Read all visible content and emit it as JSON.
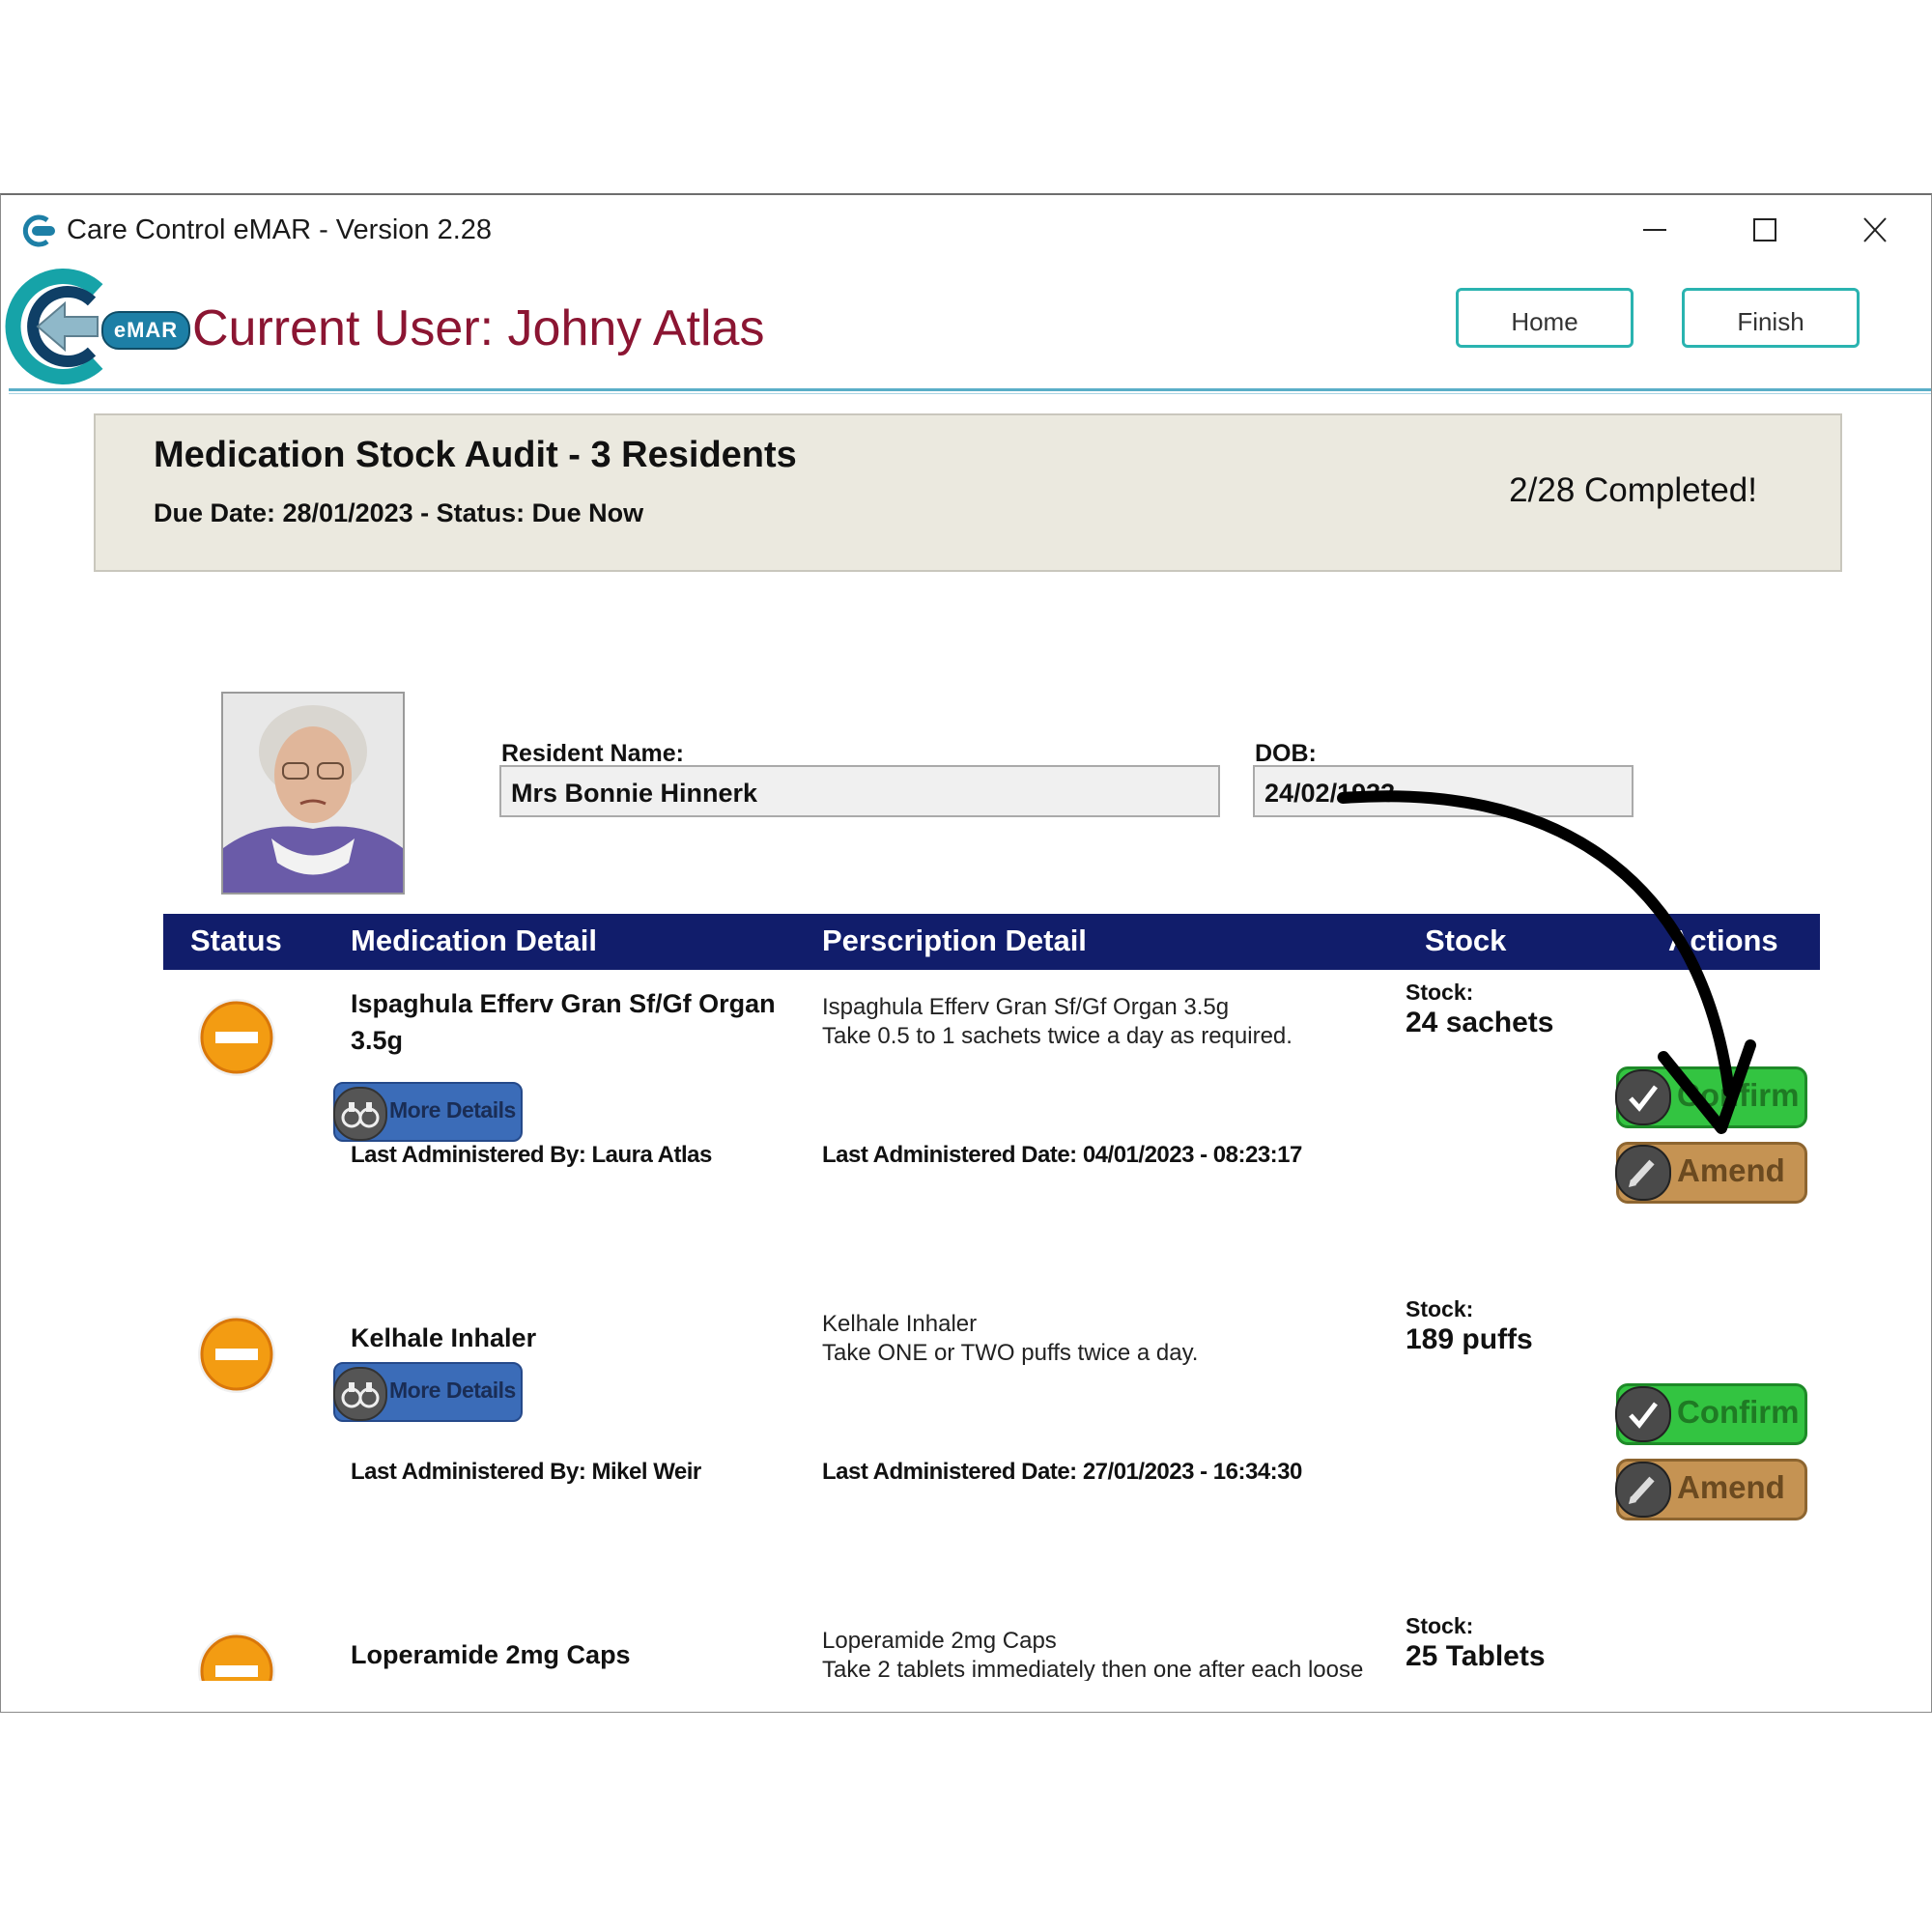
{
  "window": {
    "title": "Care Control eMAR - Version 2.28"
  },
  "header": {
    "badge": "eMAR",
    "current_user": "Current User: Johny Atlas",
    "home_label": "Home",
    "finish_label": "Finish"
  },
  "audit": {
    "title": "Medication Stock Audit - 3 Residents",
    "subtitle": "Due Date: 28/01/2023 - Status: Due Now",
    "progress": "2/28 Completed!"
  },
  "resident": {
    "name_label": "Resident Name:",
    "name": "Mrs Bonnie Hinnerk",
    "dob_label": "DOB:",
    "dob": "24/02/1933"
  },
  "table": {
    "headers": {
      "status": "Status",
      "medication": "Medication Detail",
      "prescription": "Perscription Detail",
      "stock": "Stock",
      "actions": "Actions"
    },
    "rows": [
      {
        "med_name": "Ispaghula Efferv Gran Sf/Gf Organ 3.5g",
        "more_details": "More Details",
        "last_admin_by": "Last Administered By: Laura Atlas",
        "pres_line1": "Ispaghula Efferv Gran Sf/Gf Organ 3.5g",
        "pres_line2": "Take 0.5 to 1 sachets twice a day as required.",
        "last_admin_date": "Last Administered Date: 04/01/2023 - 08:23:17",
        "stock_label": "Stock:",
        "stock": "24 sachets",
        "confirm": "Confirm",
        "amend": "Amend"
      },
      {
        "med_name": "Kelhale Inhaler",
        "more_details": "More Details",
        "last_admin_by": "Last Administered By: Mikel Weir",
        "pres_line1": "Kelhale Inhaler",
        "pres_line2": "Take ONE or TWO puffs twice a day.",
        "last_admin_date": "Last Administered Date: 27/01/2023 - 16:34:30",
        "stock_label": "Stock:",
        "stock": "189 puffs",
        "confirm": "Confirm",
        "amend": "Amend"
      },
      {
        "med_name": "Loperamide 2mg Caps",
        "pres_line1": "Loperamide 2mg Caps",
        "pres_line2": "Take 2 tablets immediately then one after each loose",
        "stock_label": "Stock:",
        "stock": "25 Tablets"
      }
    ]
  },
  "icons": {
    "status": "minus-circle-icon",
    "more_details": "binoculars-icon",
    "confirm": "checkmark-icon",
    "amend": "pencil-icon",
    "annotation": "curved-arrow"
  },
  "colors": {
    "user_text": "#8b1532",
    "table_header": "#111d6b",
    "confirm": "#33c441",
    "amend": "#c59353",
    "status_orange": "#f39c12",
    "nav_border": "#2ab3b0"
  }
}
